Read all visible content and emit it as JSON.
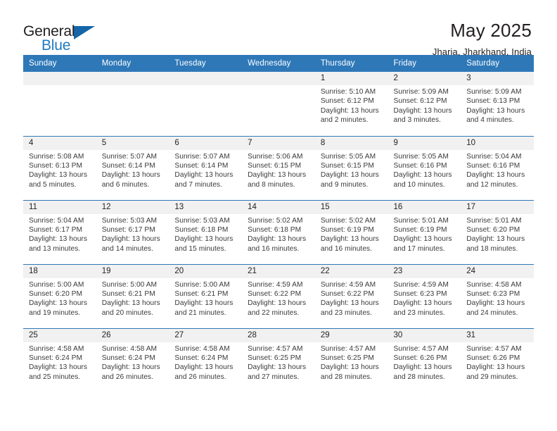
{
  "brand": {
    "name_line1": "General",
    "name_line2": "Blue",
    "primary_color": "#1f7bc1",
    "triangle_color": "#1565a8"
  },
  "header": {
    "title": "May 2025",
    "subtitle": "Jharia, Jharkhand, India"
  },
  "calendar": {
    "header_bg": "#2e78b8",
    "daynum_bg": "#f1f1f1",
    "weekdays": [
      "Sunday",
      "Monday",
      "Tuesday",
      "Wednesday",
      "Thursday",
      "Friday",
      "Saturday"
    ],
    "labels": {
      "sunrise": "Sunrise:",
      "sunset": "Sunset:",
      "daylight": "Daylight:"
    },
    "weeks": [
      [
        {
          "day": "",
          "empty": true
        },
        {
          "day": "",
          "empty": true
        },
        {
          "day": "",
          "empty": true
        },
        {
          "day": "",
          "empty": true
        },
        {
          "day": "1",
          "sunrise": "Sunrise: 5:10 AM",
          "sunset": "Sunset: 6:12 PM",
          "daylight_1": "Daylight: 13 hours",
          "daylight_2": "and 2 minutes."
        },
        {
          "day": "2",
          "sunrise": "Sunrise: 5:09 AM",
          "sunset": "Sunset: 6:12 PM",
          "daylight_1": "Daylight: 13 hours",
          "daylight_2": "and 3 minutes."
        },
        {
          "day": "3",
          "sunrise": "Sunrise: 5:09 AM",
          "sunset": "Sunset: 6:13 PM",
          "daylight_1": "Daylight: 13 hours",
          "daylight_2": "and 4 minutes."
        }
      ],
      [
        {
          "day": "4",
          "sunrise": "Sunrise: 5:08 AM",
          "sunset": "Sunset: 6:13 PM",
          "daylight_1": "Daylight: 13 hours",
          "daylight_2": "and 5 minutes."
        },
        {
          "day": "5",
          "sunrise": "Sunrise: 5:07 AM",
          "sunset": "Sunset: 6:14 PM",
          "daylight_1": "Daylight: 13 hours",
          "daylight_2": "and 6 minutes."
        },
        {
          "day": "6",
          "sunrise": "Sunrise: 5:07 AM",
          "sunset": "Sunset: 6:14 PM",
          "daylight_1": "Daylight: 13 hours",
          "daylight_2": "and 7 minutes."
        },
        {
          "day": "7",
          "sunrise": "Sunrise: 5:06 AM",
          "sunset": "Sunset: 6:15 PM",
          "daylight_1": "Daylight: 13 hours",
          "daylight_2": "and 8 minutes."
        },
        {
          "day": "8",
          "sunrise": "Sunrise: 5:05 AM",
          "sunset": "Sunset: 6:15 PM",
          "daylight_1": "Daylight: 13 hours",
          "daylight_2": "and 9 minutes."
        },
        {
          "day": "9",
          "sunrise": "Sunrise: 5:05 AM",
          "sunset": "Sunset: 6:16 PM",
          "daylight_1": "Daylight: 13 hours",
          "daylight_2": "and 10 minutes."
        },
        {
          "day": "10",
          "sunrise": "Sunrise: 5:04 AM",
          "sunset": "Sunset: 6:16 PM",
          "daylight_1": "Daylight: 13 hours",
          "daylight_2": "and 12 minutes."
        }
      ],
      [
        {
          "day": "11",
          "sunrise": "Sunrise: 5:04 AM",
          "sunset": "Sunset: 6:17 PM",
          "daylight_1": "Daylight: 13 hours",
          "daylight_2": "and 13 minutes."
        },
        {
          "day": "12",
          "sunrise": "Sunrise: 5:03 AM",
          "sunset": "Sunset: 6:17 PM",
          "daylight_1": "Daylight: 13 hours",
          "daylight_2": "and 14 minutes."
        },
        {
          "day": "13",
          "sunrise": "Sunrise: 5:03 AM",
          "sunset": "Sunset: 6:18 PM",
          "daylight_1": "Daylight: 13 hours",
          "daylight_2": "and 15 minutes."
        },
        {
          "day": "14",
          "sunrise": "Sunrise: 5:02 AM",
          "sunset": "Sunset: 6:18 PM",
          "daylight_1": "Daylight: 13 hours",
          "daylight_2": "and 16 minutes."
        },
        {
          "day": "15",
          "sunrise": "Sunrise: 5:02 AM",
          "sunset": "Sunset: 6:19 PM",
          "daylight_1": "Daylight: 13 hours",
          "daylight_2": "and 16 minutes."
        },
        {
          "day": "16",
          "sunrise": "Sunrise: 5:01 AM",
          "sunset": "Sunset: 6:19 PM",
          "daylight_1": "Daylight: 13 hours",
          "daylight_2": "and 17 minutes."
        },
        {
          "day": "17",
          "sunrise": "Sunrise: 5:01 AM",
          "sunset": "Sunset: 6:20 PM",
          "daylight_1": "Daylight: 13 hours",
          "daylight_2": "and 18 minutes."
        }
      ],
      [
        {
          "day": "18",
          "sunrise": "Sunrise: 5:00 AM",
          "sunset": "Sunset: 6:20 PM",
          "daylight_1": "Daylight: 13 hours",
          "daylight_2": "and 19 minutes."
        },
        {
          "day": "19",
          "sunrise": "Sunrise: 5:00 AM",
          "sunset": "Sunset: 6:21 PM",
          "daylight_1": "Daylight: 13 hours",
          "daylight_2": "and 20 minutes."
        },
        {
          "day": "20",
          "sunrise": "Sunrise: 5:00 AM",
          "sunset": "Sunset: 6:21 PM",
          "daylight_1": "Daylight: 13 hours",
          "daylight_2": "and 21 minutes."
        },
        {
          "day": "21",
          "sunrise": "Sunrise: 4:59 AM",
          "sunset": "Sunset: 6:22 PM",
          "daylight_1": "Daylight: 13 hours",
          "daylight_2": "and 22 minutes."
        },
        {
          "day": "22",
          "sunrise": "Sunrise: 4:59 AM",
          "sunset": "Sunset: 6:22 PM",
          "daylight_1": "Daylight: 13 hours",
          "daylight_2": "and 23 minutes."
        },
        {
          "day": "23",
          "sunrise": "Sunrise: 4:59 AM",
          "sunset": "Sunset: 6:23 PM",
          "daylight_1": "Daylight: 13 hours",
          "daylight_2": "and 23 minutes."
        },
        {
          "day": "24",
          "sunrise": "Sunrise: 4:58 AM",
          "sunset": "Sunset: 6:23 PM",
          "daylight_1": "Daylight: 13 hours",
          "daylight_2": "and 24 minutes."
        }
      ],
      [
        {
          "day": "25",
          "sunrise": "Sunrise: 4:58 AM",
          "sunset": "Sunset: 6:24 PM",
          "daylight_1": "Daylight: 13 hours",
          "daylight_2": "and 25 minutes."
        },
        {
          "day": "26",
          "sunrise": "Sunrise: 4:58 AM",
          "sunset": "Sunset: 6:24 PM",
          "daylight_1": "Daylight: 13 hours",
          "daylight_2": "and 26 minutes."
        },
        {
          "day": "27",
          "sunrise": "Sunrise: 4:58 AM",
          "sunset": "Sunset: 6:24 PM",
          "daylight_1": "Daylight: 13 hours",
          "daylight_2": "and 26 minutes."
        },
        {
          "day": "28",
          "sunrise": "Sunrise: 4:57 AM",
          "sunset": "Sunset: 6:25 PM",
          "daylight_1": "Daylight: 13 hours",
          "daylight_2": "and 27 minutes."
        },
        {
          "day": "29",
          "sunrise": "Sunrise: 4:57 AM",
          "sunset": "Sunset: 6:25 PM",
          "daylight_1": "Daylight: 13 hours",
          "daylight_2": "and 28 minutes."
        },
        {
          "day": "30",
          "sunrise": "Sunrise: 4:57 AM",
          "sunset": "Sunset: 6:26 PM",
          "daylight_1": "Daylight: 13 hours",
          "daylight_2": "and 28 minutes."
        },
        {
          "day": "31",
          "sunrise": "Sunrise: 4:57 AM",
          "sunset": "Sunset: 6:26 PM",
          "daylight_1": "Daylight: 13 hours",
          "daylight_2": "and 29 minutes."
        }
      ]
    ]
  }
}
